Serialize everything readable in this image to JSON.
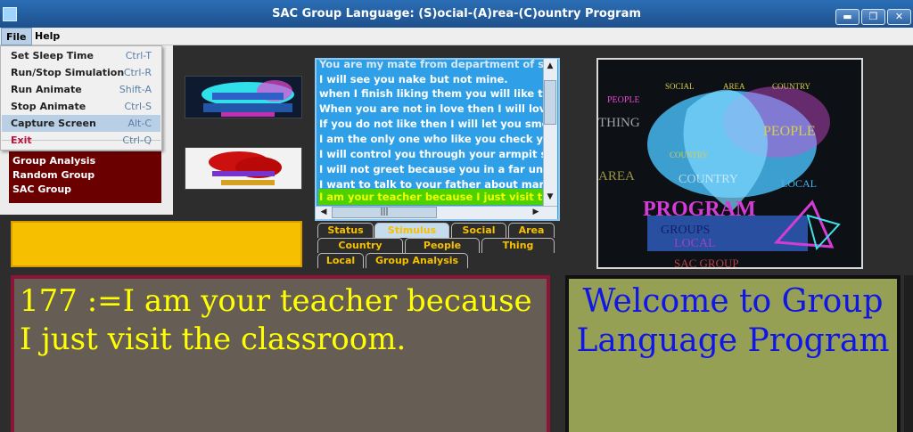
{
  "window": {
    "title": "SAC Group Language: (S)ocial-(A)rea-(C)ountry Program",
    "controls": [
      "minimize-icon",
      "restore-icon",
      "close-icon"
    ],
    "control_glyphs": [
      "▬",
      "❐",
      "✕"
    ]
  },
  "menubar": {
    "file": "File",
    "help": "Help"
  },
  "file_menu": {
    "items": [
      {
        "label": "Set Sleep Time",
        "accel": "Ctrl-T"
      },
      {
        "label": "Run/Stop Simulation",
        "accel": "Ctrl-R"
      },
      {
        "label": "Run Animate",
        "accel": "Shift-A"
      },
      {
        "label": "Stop Animate",
        "accel": "Ctrl-S"
      },
      {
        "label": "Capture Screen",
        "accel": "Alt-C"
      },
      {
        "label": "Exit",
        "accel": "Ctrl-Q"
      }
    ],
    "selected_index": 4
  },
  "group_list": [
    "Group Analysis",
    "Random Group",
    "SAC Group"
  ],
  "sentences": {
    "items": [
      "You are my mate from department of sci",
      "I will see you nake but not mine.",
      "when I finish liking them you will like th",
      "When you are not in love then I will love",
      "If you do not like then I will let you sme",
      "I am the only one who like you check yo",
      "I will control you through your armpit sm",
      "I will not greet because you in a far univ",
      "I want to talk to your father about marri",
      "I am your teacher because I just visit the"
    ],
    "selected_index": 9,
    "scroll_arrows": {
      "up": "▲",
      "down": "▼",
      "left": "◀",
      "right": "▶"
    },
    "grip": "|||"
  },
  "tabs": {
    "row1": [
      "Status",
      "Stimulus",
      "Social",
      "Area"
    ],
    "row2": [
      "Country",
      "People",
      "Thing"
    ],
    "row3": [
      "Local",
      "Group Analysis"
    ],
    "active": "Stimulus"
  },
  "right_image": {
    "title_words": [
      "SOCIAL",
      "AREA",
      "COUNTRY"
    ],
    "words": [
      "PEOPLE",
      "THING",
      "PEOPLE",
      "COUNTRY",
      "AREA",
      "COUNTRY",
      "LOCAL",
      "PROGRAM",
      "GROUPS",
      "LOCAL",
      "SAC GROUP"
    ]
  },
  "current_sentence": "177 :=I am your teacher because I just visit the classroom.",
  "welcome": "Welcome to Group Language Program",
  "colors": {
    "selected_row": "#4cd200",
    "sentence_text": "#ffff00",
    "welcome_text": "#1016e6",
    "tab_text": "#f6c000"
  }
}
